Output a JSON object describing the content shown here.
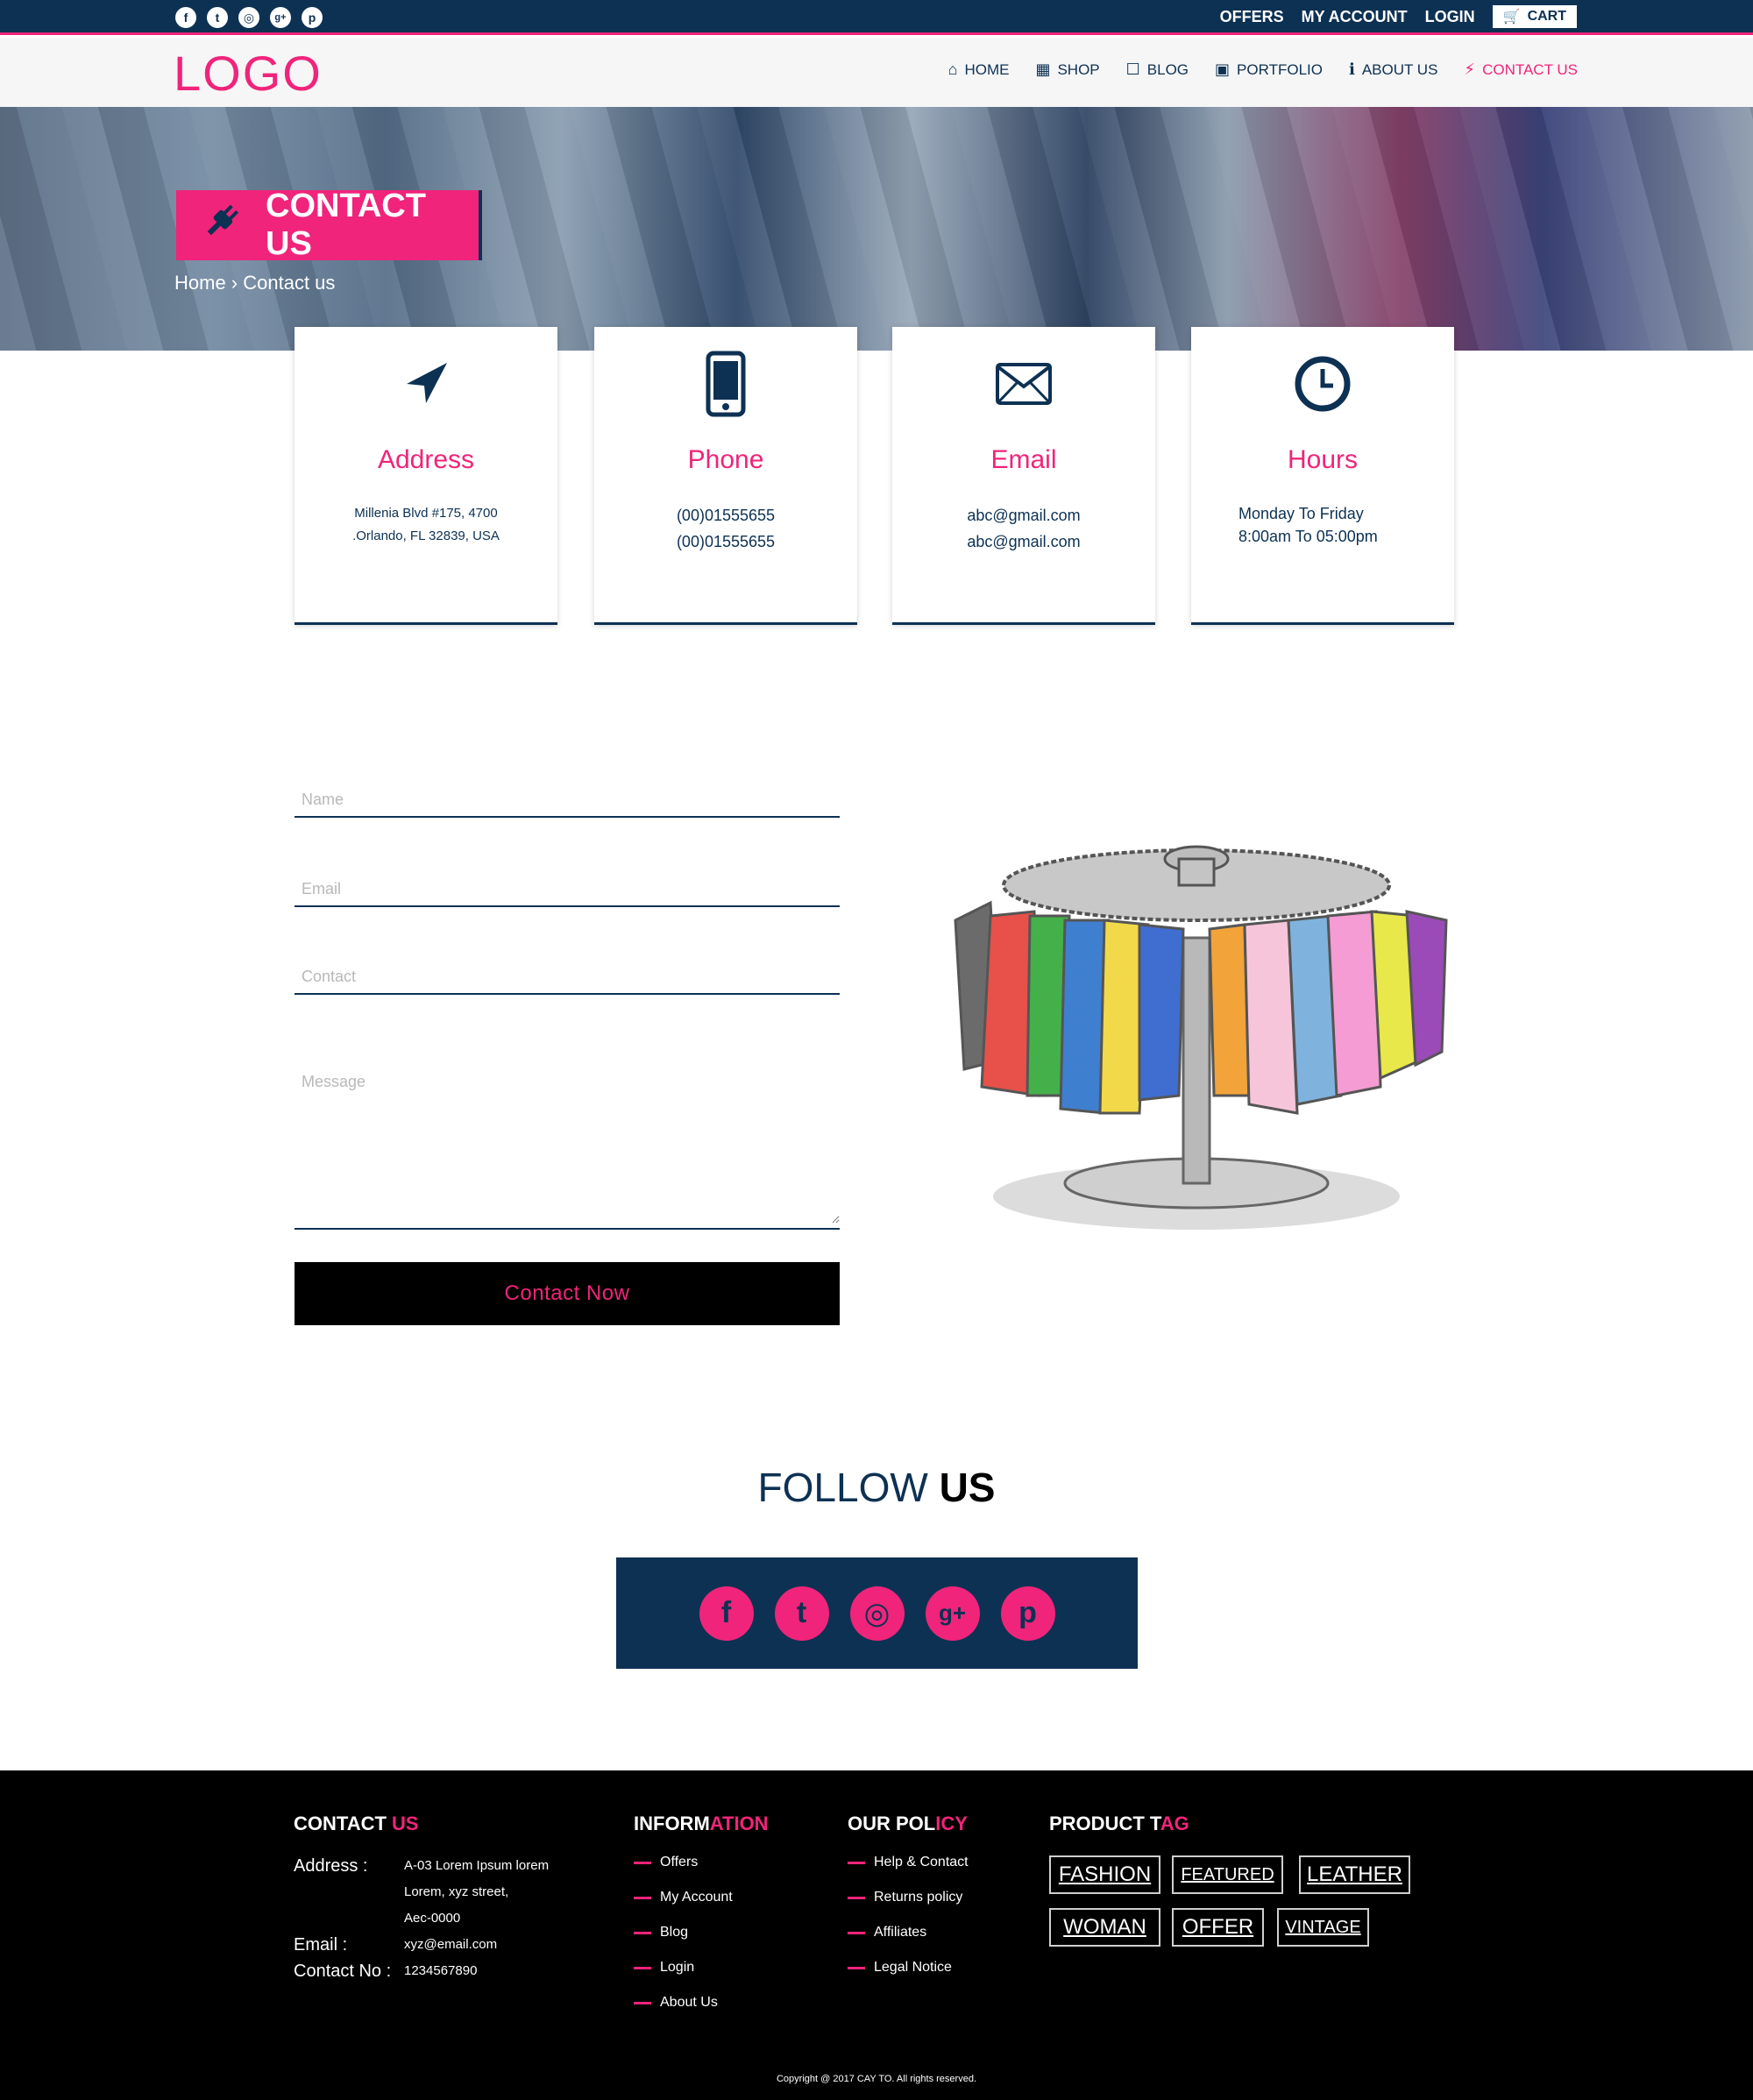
{
  "topbar": {
    "social": [
      {
        "icon": "facebook-icon",
        "glyph": "f"
      },
      {
        "icon": "twitter-icon",
        "glyph": "t"
      },
      {
        "icon": "instagram-icon",
        "glyph": "◎"
      },
      {
        "icon": "google-plus-icon",
        "glyph": "g+"
      },
      {
        "icon": "pinterest-icon",
        "glyph": "p"
      }
    ],
    "offers": "OFFERS",
    "my_account": "MY ACCOUNT",
    "login": "LOGIN",
    "cart": "CART"
  },
  "nav": {
    "logo": "LOGO",
    "items": [
      {
        "label": "HOME",
        "icon": "home-icon"
      },
      {
        "label": "SHOP",
        "icon": "shopping-bag-icon"
      },
      {
        "label": "BLOG",
        "icon": "note-icon"
      },
      {
        "label": "PORTFOLIO",
        "icon": "image-icon"
      },
      {
        "label": "ABOUT US",
        "icon": "info-icon"
      },
      {
        "label": "CONTACT US",
        "icon": "plug-icon"
      }
    ]
  },
  "hero": {
    "title": "CONTACT US",
    "breadcrumb": "Home › Contact us"
  },
  "cards": [
    {
      "title": "Address",
      "icon": "navigation-arrow-icon",
      "lines": [
        "Millenia Blvd #175, 4700",
        ".Orlando, FL 32839, USA"
      ]
    },
    {
      "title": "Phone",
      "icon": "mobile-phone-icon",
      "lines": [
        "(00)01555655",
        "(00)01555655"
      ]
    },
    {
      "title": "Email",
      "icon": "envelope-icon",
      "lines": [
        "abc@gmail.com",
        "abc@gmail.com"
      ]
    },
    {
      "title": "Hours",
      "icon": "clock-icon",
      "lines": [
        "Monday To Friday",
        "8:00am To 05:00pm"
      ]
    }
  ],
  "form": {
    "name_placeholder": "Name",
    "email_placeholder": "Email",
    "contact_placeholder": "Contact",
    "message_placeholder": "Message",
    "submit": "Contact Now"
  },
  "follow": {
    "title_part1": "FOLLOW ",
    "title_part2": "US",
    "icons": [
      {
        "icon": "facebook-icon",
        "glyph": "f"
      },
      {
        "icon": "twitter-icon",
        "glyph": "t"
      },
      {
        "icon": "instagram-icon",
        "glyph": "◎"
      },
      {
        "icon": "google-plus-icon",
        "glyph": "g+"
      },
      {
        "icon": "pinterest-icon",
        "glyph": "p"
      }
    ]
  },
  "footer": {
    "contact": {
      "heading_a": "CONTACT ",
      "heading_b": "US",
      "address_label": "Address :",
      "address_lines": [
        "A-03 Lorem Ipsum lorem",
        "Lorem, xyz street,",
        "Aec-0000"
      ],
      "email_label": "Email :",
      "email": "xyz@email.com",
      "contact_label": "Contact No :",
      "contact": "1234567890"
    },
    "information": {
      "heading_a": "INFORM",
      "heading_b": "ATION",
      "items": [
        "Offers",
        "My Account",
        "Blog",
        "Login",
        "About Us"
      ]
    },
    "policy": {
      "heading_a": "OUR POL",
      "heading_b": "ICY",
      "items": [
        "Help & Contact",
        "Returns policy",
        "Affiliates",
        "Legal Notice"
      ]
    },
    "tags": {
      "heading_a": "PRODUCT T",
      "heading_b": "AG",
      "items": [
        "FASHION",
        "FEATURED",
        "LEATHER",
        "WOMAN",
        "OFFER",
        "VINTAGE"
      ]
    },
    "copyright": "Copyright @ 2017 CAY TO. All rights reserved."
  },
  "colors": {
    "navy": "#0d3153",
    "pink": "#f0247a",
    "black": "#000000"
  }
}
